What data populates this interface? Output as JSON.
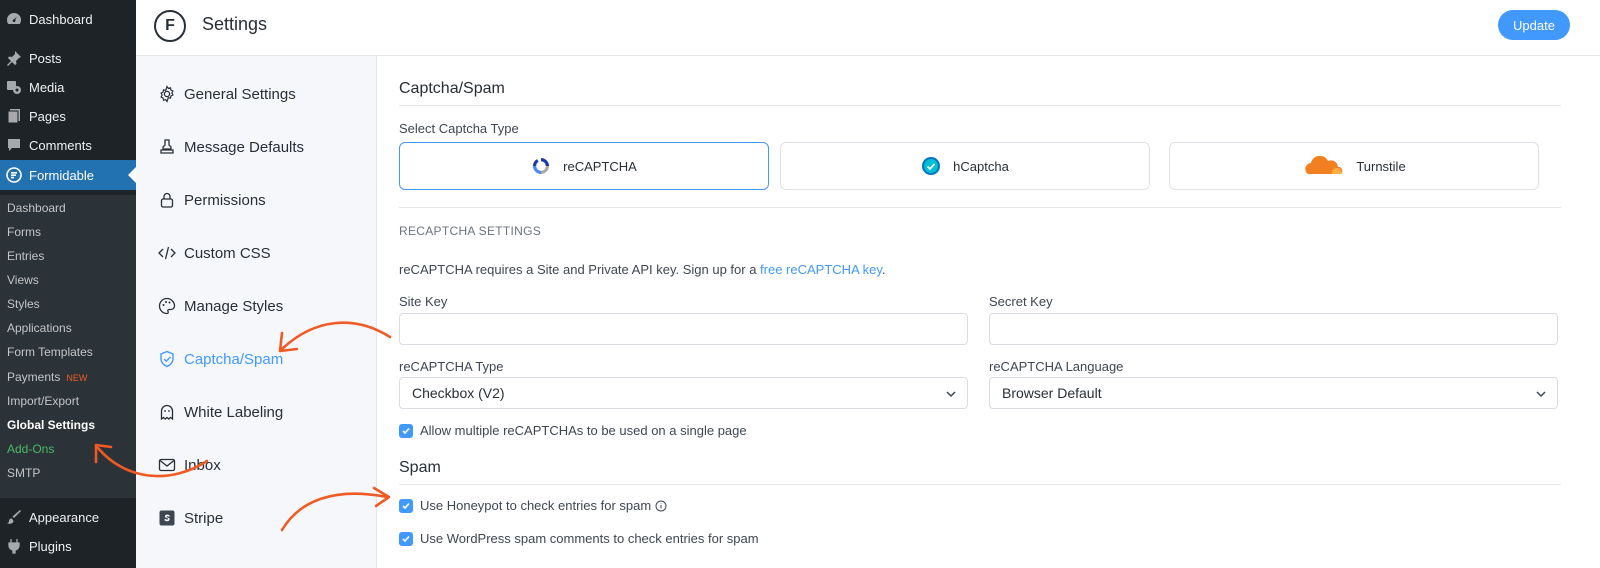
{
  "wp_menu": {
    "top_items": [
      {
        "label": "Dashboard",
        "icon": "dashboard-icon"
      },
      {
        "label": "Posts",
        "icon": "pin-icon"
      },
      {
        "label": "Media",
        "icon": "media-icon"
      },
      {
        "label": "Pages",
        "icon": "pages-icon"
      },
      {
        "label": "Comments",
        "icon": "comments-icon"
      },
      {
        "label": "Formidable",
        "icon": "formidable-icon"
      }
    ],
    "sub_items": [
      {
        "label": "Dashboard"
      },
      {
        "label": "Forms"
      },
      {
        "label": "Entries"
      },
      {
        "label": "Views"
      },
      {
        "label": "Styles"
      },
      {
        "label": "Applications"
      },
      {
        "label": "Form Templates"
      },
      {
        "label": "Payments",
        "badge": "NEW"
      },
      {
        "label": "Import/Export"
      },
      {
        "label": "Global Settings"
      },
      {
        "label": "Add-Ons"
      },
      {
        "label": "SMTP"
      }
    ],
    "bottom_items": [
      {
        "label": "Appearance",
        "icon": "brush-icon"
      },
      {
        "label": "Plugins",
        "icon": "plug-icon"
      }
    ]
  },
  "header": {
    "logo_letter": "F",
    "title": "Settings",
    "update_label": "Update"
  },
  "settings_nav": [
    {
      "label": "General Settings",
      "icon": "gear-icon"
    },
    {
      "label": "Message Defaults",
      "icon": "stamp-icon"
    },
    {
      "label": "Permissions",
      "icon": "lock-icon"
    },
    {
      "label": "Custom CSS",
      "icon": "code-icon"
    },
    {
      "label": "Manage Styles",
      "icon": "palette-icon"
    },
    {
      "label": "Captcha/Spam",
      "icon": "shield-check-icon"
    },
    {
      "label": "White Labeling",
      "icon": "ghost-icon"
    },
    {
      "label": "Inbox",
      "icon": "envelope-icon"
    },
    {
      "label": "Stripe",
      "icon": "stripe-icon"
    }
  ],
  "main": {
    "title": "Captcha/Spam",
    "captcha_type_label": "Select Captcha Type",
    "captcha_options": [
      {
        "label": "reCAPTCHA",
        "icon": "recaptcha-icon",
        "selected": true
      },
      {
        "label": "hCaptcha",
        "icon": "hcaptcha-icon",
        "selected": false
      },
      {
        "label": "Turnstile",
        "icon": "cloudflare-icon",
        "selected": false
      }
    ],
    "recaptcha_settings_heading": "RECAPTCHA SETTINGS",
    "info_text": "reCAPTCHA requires a Site and Private API key. Sign up for a ",
    "info_link": "free reCAPTCHA key",
    "info_end": ".",
    "site_key_label": "Site Key",
    "site_key_value": "",
    "secret_key_label": "Secret Key",
    "secret_key_value": "",
    "recaptcha_type_label": "reCAPTCHA Type",
    "recaptcha_type_value": "Checkbox (V2)",
    "recaptcha_language_label": "reCAPTCHA Language",
    "recaptcha_language_value": "Browser Default",
    "allow_multiple_label": "Allow multiple reCAPTCHAs to be used on a single page",
    "spam_title": "Spam",
    "honeypot_label": "Use Honeypot to check entries for spam",
    "wp_spam_label": "Use WordPress spam comments to check entries for spam"
  },
  "colors": {
    "accent": "#4199fd",
    "wp_dark": "#1d2327",
    "annotation_arrow": "#f05a24"
  }
}
